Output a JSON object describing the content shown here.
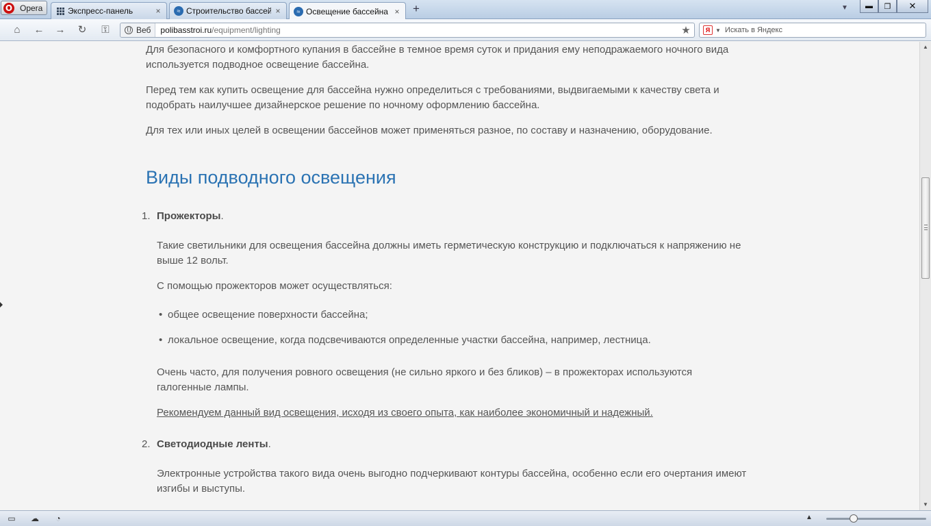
{
  "browser": {
    "menu_label": "Opera",
    "tabs": [
      {
        "label": "Экспресс-панель",
        "icon": "grid-icon"
      },
      {
        "label": "Строительство бассей...",
        "icon": "pool-favicon-icon"
      },
      {
        "label": "Освещение бассейна",
        "icon": "pool-favicon-icon"
      }
    ],
    "tab_close": "×",
    "new_tab": "+",
    "window_buttons": {
      "minimize": "▬",
      "restore": "❐",
      "close": "✕"
    }
  },
  "address_bar": {
    "mode_label": "Веб",
    "url_domain": "polibasstroi.ru",
    "url_path": "/equipment/lighting"
  },
  "search": {
    "placeholder": "Искать в Яндекс",
    "engine_letter": "Я"
  },
  "article": {
    "intro": [
      "Для безопасного и комфортного купания в бассейне в темное время суток и придания ему неподражаемого ночного вида используется подводное освещение бассейна.",
      "Перед тем как купить освещение для бассейна нужно определиться с требованиями, выдвигаемыми к качеству света и подобрать наилучшее дизайнерское решение по ночному оформлению бассейна.",
      "Для тех или иных целей в освещении бассейнов может применяться разное, по составу и назначению, оборудование."
    ],
    "section_heading": "Виды подводного освещения",
    "items": [
      {
        "number": "1.",
        "title": "Прожекторы",
        "p1": "Такие светильники для освещения бассейна должны иметь герметическую конструкцию и подключаться к напряжению не выше 12 вольт.",
        "p2": "С помощью прожекторов может осуществляться:",
        "bullets": [
          "общее освещение поверхности бассейна;",
          "локальное освещение, когда подсвечиваются определенные участки бассейна, например, лестница."
        ],
        "p3": "Очень часто, для получения ровного освещения (не сильно яркого и без бликов) – в прожекторах используются галогенные лампы.",
        "recommendation": "Рекомендуем данный вид освещения, исходя из своего опыта, как наиболее экономичный и надежный."
      },
      {
        "number": "2.",
        "title": "Светодиодные ленты",
        "p1": "Электронные устройства такого вида очень выгодно подчеркивают контуры бассейна, особенно если его очертания имеют изгибы и выступы."
      }
    ],
    "bullet_char": "•",
    "title_suffix": "."
  },
  "colors": {
    "heading": "#2b73b3",
    "text": "#555555",
    "background": "#f4f4f4"
  }
}
